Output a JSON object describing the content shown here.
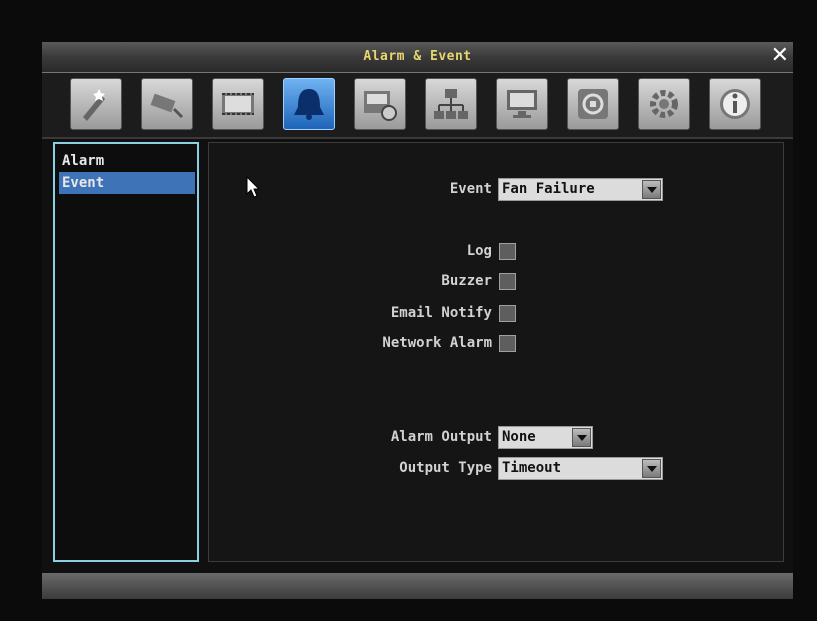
{
  "window": {
    "title": "Alarm & Event",
    "close_label": "✕"
  },
  "toolbar": {
    "items": [
      {
        "name": "quick-setup-icon",
        "active": false
      },
      {
        "name": "camera-icon",
        "active": false
      },
      {
        "name": "record-icon",
        "active": false
      },
      {
        "name": "alarm-bell-icon",
        "active": true
      },
      {
        "name": "schedule-icon",
        "active": false
      },
      {
        "name": "network-icon",
        "active": false
      },
      {
        "name": "display-icon",
        "active": false
      },
      {
        "name": "backup-icon",
        "active": false
      },
      {
        "name": "system-gear-icon",
        "active": false
      },
      {
        "name": "info-icon",
        "active": false
      }
    ]
  },
  "sidebar": {
    "items": [
      {
        "label": "Alarm",
        "selected": false
      },
      {
        "label": "Event",
        "selected": true
      }
    ]
  },
  "form": {
    "event": {
      "label": "Event",
      "value": "Fan Failure"
    },
    "log": {
      "label": "Log",
      "checked": false
    },
    "buzzer": {
      "label": "Buzzer",
      "checked": false
    },
    "email_notify": {
      "label": "Email Notify",
      "checked": false
    },
    "network_alarm": {
      "label": "Network Alarm",
      "checked": false
    },
    "alarm_output": {
      "label": "Alarm Output",
      "value": "None"
    },
    "output_type": {
      "label": "Output Type",
      "value": "Timeout"
    }
  },
  "colors": {
    "accent": "#3f73b8",
    "title": "#e7d56e",
    "panel_border": "#8fcfe3"
  }
}
